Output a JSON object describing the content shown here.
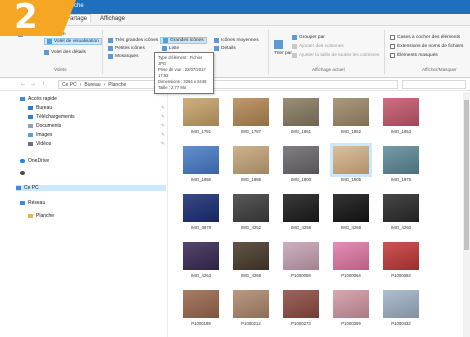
{
  "badge": "2",
  "window": {
    "title": "Planche"
  },
  "tabs": {
    "partage": "Partage",
    "affichage": "Affichage"
  },
  "ribbon": {
    "volet_navigation": "Volet de navigation",
    "volet_visualisation": "Volet de visualisation",
    "volet_details": "Volet des détails",
    "tres_grandes": "Très grandes icônes",
    "petites": "Petites icônes",
    "mosaiques": "Mosaïques",
    "grandes": "Grandes icônes",
    "liste": "Liste",
    "contenu": "Contenu",
    "moyennes": "Icônes moyennes",
    "details": "Détails",
    "trier_par": "Trier par",
    "grouper_par": "Grouper par",
    "ajouter_colonnes": "Ajouter des colonnes",
    "ajuster_colonnes": "Ajuster la taille de toutes les colonnes",
    "cases": "Cases à cocher des éléments",
    "extensions": "Extensions de noms de fichiers",
    "masques": "Éléments masqués",
    "group_volets": "Volets",
    "group_disposition": "Disposition",
    "group_affichage_actuel": "Affichage actuel",
    "group_afficher_masquer": "Afficher/Masquer"
  },
  "nav": {
    "back": "←",
    "forward": "→",
    "up": "↑",
    "path": [
      "Ce PC",
      "Bureau",
      "Planche"
    ]
  },
  "sidebar": {
    "acces_rapide": "Accès rapide",
    "bureau": "Bureau",
    "telechargements": "Téléchargements",
    "documents": "Documents",
    "images": "Images",
    "videos": "Vidéos",
    "onedrive": "OneDrive",
    "ce_pc": "Ce PC",
    "reseau": "Réseau",
    "planche": "Planche"
  },
  "files": [
    {
      "name": "IMG_1781",
      "color": "#c9a46a"
    },
    {
      "name": "IMG_1787",
      "color": "#b78a55"
    },
    {
      "name": "IMG_1851",
      "color": "#8a7d63"
    },
    {
      "name": "IMG_1852",
      "color": "#a08b6b"
    },
    {
      "name": "IMG_1853",
      "color": "#c65a6e"
    },
    {
      "name": "IMG_1856",
      "color": "#4a7ec9"
    },
    {
      "name": "IMG_1888",
      "color": "#c7a77b"
    },
    {
      "name": "IMG_1900",
      "color": "#6d6a70"
    },
    {
      "name": "IMG_1905",
      "color": "#d9b58a"
    },
    {
      "name": "IMG_1975",
      "color": "#5f8c9a"
    },
    {
      "name": "IMG_3878",
      "color": "#1b2e78"
    },
    {
      "name": "IMG_4252",
      "color": "#3f3f3f"
    },
    {
      "name": "IMG_4256",
      "color": "#1c1c1c"
    },
    {
      "name": "IMG_4258",
      "color": "#151515"
    },
    {
      "name": "IMG_4260",
      "color": "#2b2b2b"
    },
    {
      "name": "IMG_4263",
      "color": "#3a2a55"
    },
    {
      "name": "IMG_4268",
      "color": "#4a3b2c"
    },
    {
      "name": "P1000058",
      "color": "#c8a4b8"
    },
    {
      "name": "P1000064",
      "color": "#e47aa8"
    },
    {
      "name": "P1000084",
      "color": "#c43a3a"
    },
    {
      "name": "P1000189",
      "color": "#9c6a4e"
    },
    {
      "name": "P1000212",
      "color": "#b08a6e"
    },
    {
      "name": "P1000273",
      "color": "#8f4d44"
    },
    {
      "name": "P1000359",
      "color": "#d49aa6"
    },
    {
      "name": "P1000432",
      "color": "#a3b5c8"
    }
  ],
  "tooltip": {
    "type": "Type d'élément : Fichier JPG",
    "date": "Prise de vue : 22/07/2017 17:52",
    "dims": "Dimensions : 3264 x 2448",
    "size": "Taille : 2,77 Mo"
  }
}
